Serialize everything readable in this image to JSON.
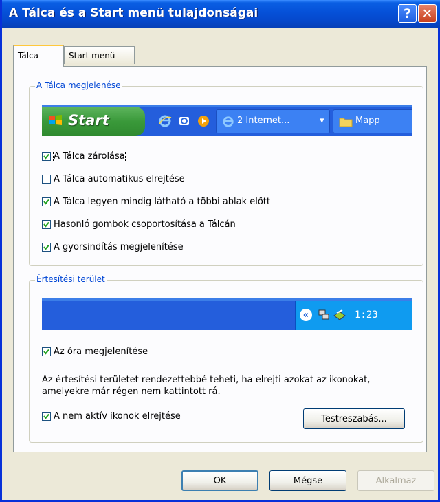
{
  "window": {
    "title": "A Tálca és a Start menü tulajdonságai",
    "help_label": "?",
    "close_label": "✕"
  },
  "tabs": [
    {
      "label": "Tálca",
      "active": true
    },
    {
      "label": "Start menü",
      "active": false
    }
  ],
  "taskbar_group": {
    "label": "A Tálca megjelenése",
    "preview": {
      "start_label": "Start",
      "quick_launch_icons": [
        "ie-icon",
        "outlook-express-icon",
        "media-player-icon"
      ],
      "task_buttons": [
        {
          "icon": "ie-icon",
          "label": "2 Internet...",
          "dropdown": "▾"
        },
        {
          "icon": "folder-icon",
          "label": "Mapp"
        }
      ]
    },
    "options": [
      {
        "label": "A Tálca zárolása",
        "checked": true
      },
      {
        "label": "A Tálca automatikus elrejtése",
        "checked": false
      },
      {
        "label": "A Tálca legyen mindig látható a többi ablak előtt",
        "checked": true
      },
      {
        "label": "Hasonló gombok csoportosítása a Tálcán",
        "checked": true
      },
      {
        "label": "A gyorsindítás megjelenítése",
        "checked": true
      }
    ]
  },
  "notification_group": {
    "label": "Értesítési terület",
    "preview": {
      "chevron": "«",
      "tray_icons": [
        "network-icon",
        "safely-remove-icon"
      ],
      "clock": "1:23"
    },
    "show_clock": {
      "label": "Az óra megjelenítése",
      "checked": true
    },
    "description": "Az értesítési területet rendezettebbé teheti, ha elrejti azokat az ikonokat, amelyekre már régen nem kattintott rá.",
    "hide_inactive": {
      "label": "A nem aktív ikonok elrejtése",
      "checked": true
    },
    "customize_label": "Testreszabás..."
  },
  "buttons": {
    "ok": "OK",
    "cancel": "Mégse",
    "apply": "Alkalmaz"
  },
  "colors": {
    "titlebar": "#0550D8",
    "dialog_bg": "#ECE9D8",
    "group_label": "#0046D5",
    "taskbar": "#245EDC",
    "tray": "#0F9BF0"
  }
}
